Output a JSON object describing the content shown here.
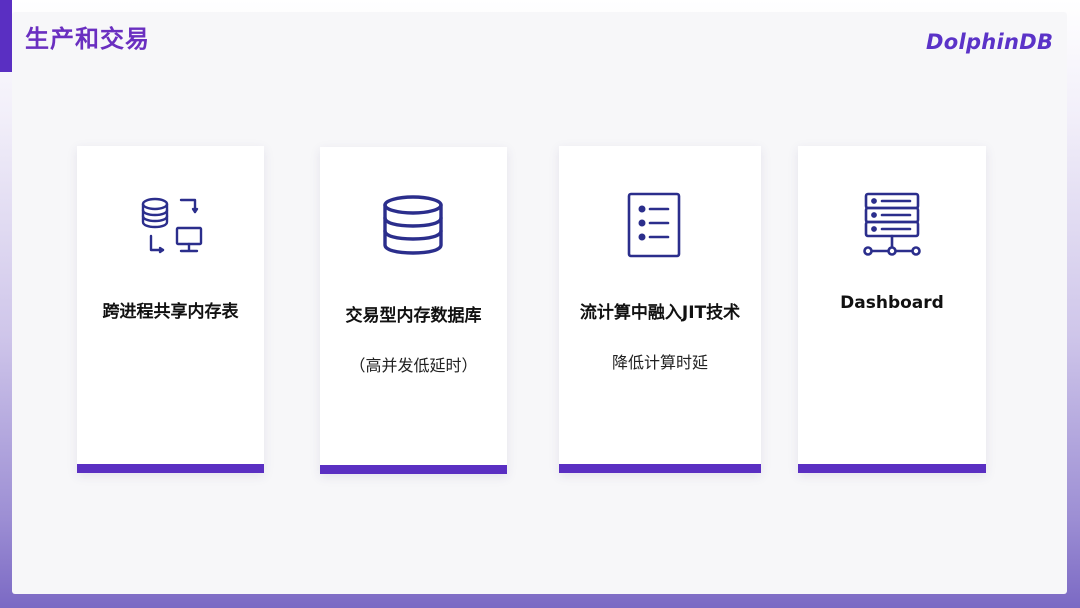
{
  "header": {
    "title": "生产和交易",
    "brand": "DolphinDB"
  },
  "colors": {
    "accent": "#5a2fc2",
    "title": "#6a2fc0",
    "icon": "#2b2e8c"
  },
  "cards": [
    {
      "icon": "database-network-icon",
      "title": "跨进程共享内存表",
      "subtitle": ""
    },
    {
      "icon": "database-icon",
      "title": "交易型内存数据库",
      "subtitle": "（高并发低延时）"
    },
    {
      "icon": "list-document-icon",
      "title": "流计算中融入JIT技术",
      "subtitle": "降低计算时延"
    },
    {
      "icon": "server-stack-icon",
      "title": "Dashboard",
      "subtitle": ""
    }
  ]
}
